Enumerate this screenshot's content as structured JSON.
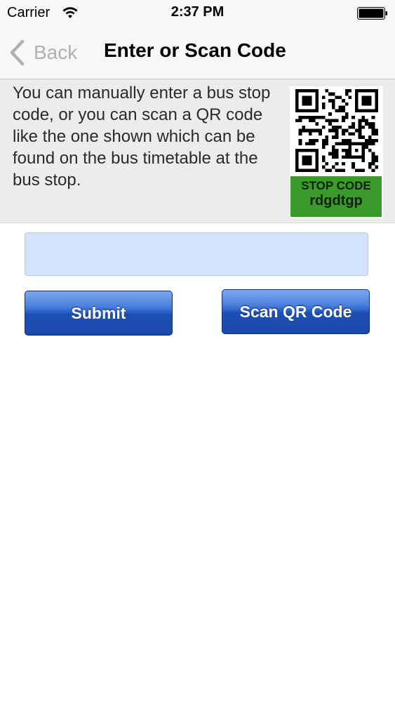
{
  "status_bar": {
    "carrier": "Carrier",
    "time": "2:37 PM",
    "wifi_icon": "wifi-icon",
    "battery_icon": "battery-icon"
  },
  "nav": {
    "back_label": "Back",
    "title": "Enter or Scan Code"
  },
  "info": {
    "text": "You can manually enter a bus stop code, or you can scan a QR code like the one shown which can be found on the bus timetable at the bus stop.",
    "qr_icon": "qr-code-icon",
    "stop_code_label": "STOP CODE",
    "stop_code_value": "rdgdtgp"
  },
  "form": {
    "input_value": "",
    "input_placeholder": "",
    "submit_label": "Submit",
    "scan_label": "Scan QR Code"
  },
  "colors": {
    "input_background": "#d3e3fb",
    "button_blue": "#1d4fb3",
    "stop_code_green": "#3a9b2b",
    "panel_gray": "#ececec"
  }
}
